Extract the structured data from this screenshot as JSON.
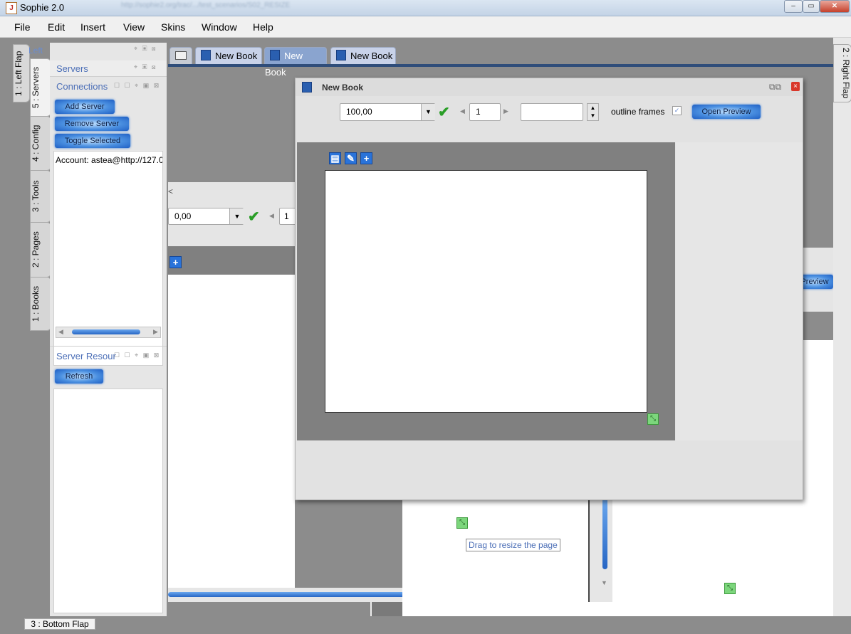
{
  "window": {
    "title": "Sophie 2.0",
    "blurred_path": "http://sophie2.org/trac/.../test_scenarios/S02_RESIZE"
  },
  "menu": [
    "File",
    "Edit",
    "Insert",
    "View",
    "Skins",
    "Window",
    "Help"
  ],
  "left_flap": {
    "header": "Left",
    "vertical_tab_left": "1 : Left Flap",
    "tabs": [
      "5 : Servers",
      "4 : Config",
      "3 : Tools",
      "2 : Pages",
      "1 : Books"
    ],
    "servers_title": "Servers",
    "connections_title": "Connections",
    "buttons": [
      "Add Server",
      "Remove Server",
      "Toggle Selected"
    ],
    "account_text": "Account: astea@http://127.0",
    "server_resources_title": "Server Resour",
    "refresh_label": "Refresh"
  },
  "right_flap_label": "2 : Right Flap",
  "bottom_flap_label": "3 : Bottom Flap",
  "doc_tabs": [
    "New Book",
    "New Book",
    "New Book"
  ],
  "bg_window": {
    "zoom": "0,00",
    "page": "1",
    "preview": "Preview",
    "back_arrow": "<"
  },
  "front_window": {
    "title": "New Book",
    "zoom_value": "100,00",
    "page_value": "1",
    "outline_label": "outline frames",
    "open_preview": "Open Preview"
  },
  "tooltip": "Drag to resize the page",
  "colors": {
    "accent_blue": "#4c6fb7",
    "check_green": "#2a9e27",
    "page_gray": "#808080"
  }
}
